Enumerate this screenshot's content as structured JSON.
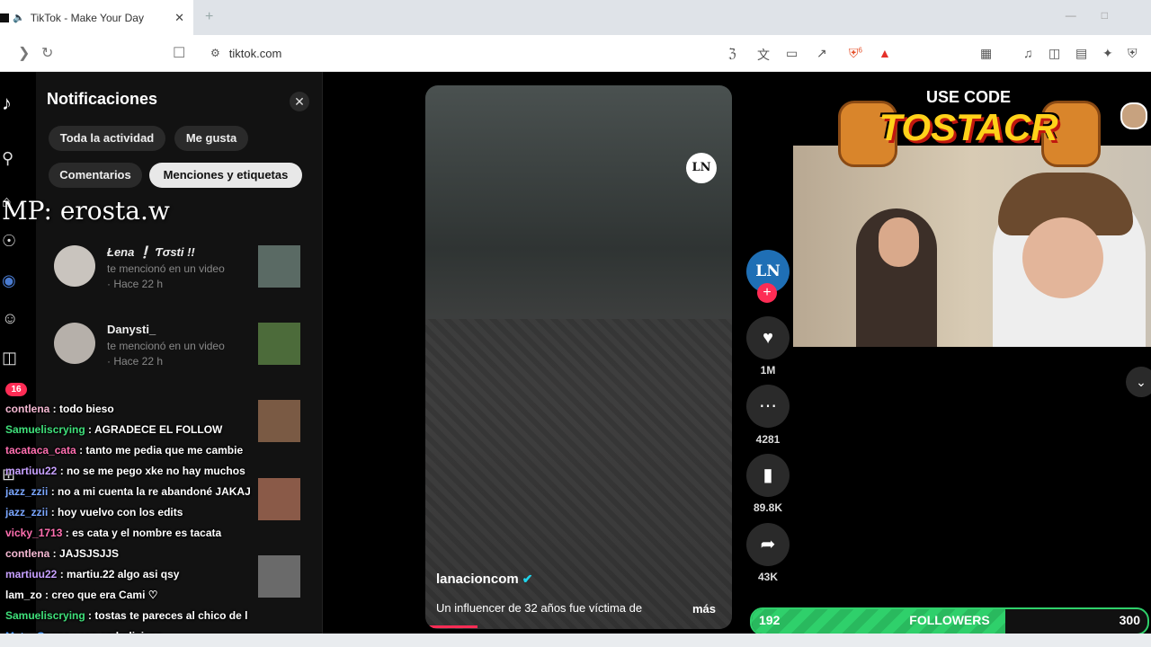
{
  "browser": {
    "tab_title": "TikTok - Make Your Day",
    "new_tab": "+",
    "url": "tiktok.com",
    "shield_count": "6"
  },
  "watermark": "MP: erosta.w",
  "notifications": {
    "title": "Notificaciones",
    "chips": [
      "Toda la actividad",
      "Me gusta",
      "Comentarios",
      "Menciones y etiquetas"
    ],
    "active_chip": "Menciones y etiquetas",
    "items": [
      {
        "name": "Łena ❕ Ƭσsti !!",
        "text": "te mencionó en un video",
        "time": "· Hace 22 h"
      },
      {
        "name": "Danysti_",
        "text": "te mencionó en un video",
        "time": "· Hace 22 h"
      }
    ]
  },
  "chat": {
    "badge": "16",
    "lines": [
      {
        "user": "contlena",
        "msg": "todo bieso"
      },
      {
        "user": "Samueliscrying",
        "msg": "AGRADECE EL FOLLOW"
      },
      {
        "user": "tacataca_cata",
        "msg": "tanto me pedia que me cambie"
      },
      {
        "user": "martiuu22",
        "msg": "no se me pego xke no hay muchos"
      },
      {
        "user": "jazz_zzii",
        "msg": "no a mi cuenta la re abandoné JAKAJ"
      },
      {
        "user": "jazz_zzii",
        "msg": "hoy vuelvo con los edits"
      },
      {
        "user": "vicky_1713",
        "msg": "es cata y el nombre es tacata"
      },
      {
        "user": "contlena",
        "msg": "JAJSJSJJS"
      },
      {
        "user": "martiuu22",
        "msg": "martiu.22 algo asi qsy"
      },
      {
        "user": "lam_zo",
        "msg": "creo que era Cami ♡"
      },
      {
        "user": "Samueliscrying",
        "msg": "tostas te pareces al chico de l"
      },
      {
        "user": "MateoGoonz",
        "msg": "ese es boliviano"
      }
    ]
  },
  "video": {
    "logo": "LN",
    "author": "lanacioncom",
    "caption": "Un influencer de 32 años fue víctima de",
    "more": "más",
    "progress": 0.17
  },
  "actions": {
    "avatar": "LN",
    "likes": "1M",
    "comments": "4281",
    "saves": "89.8K",
    "shares": "43K"
  },
  "promo": {
    "use_code": "USE CODE",
    "code": "TOSTACR"
  },
  "followers": {
    "current": "192",
    "label": "FOLLOWERS",
    "goal": "300",
    "fill_fraction": 0.64
  }
}
